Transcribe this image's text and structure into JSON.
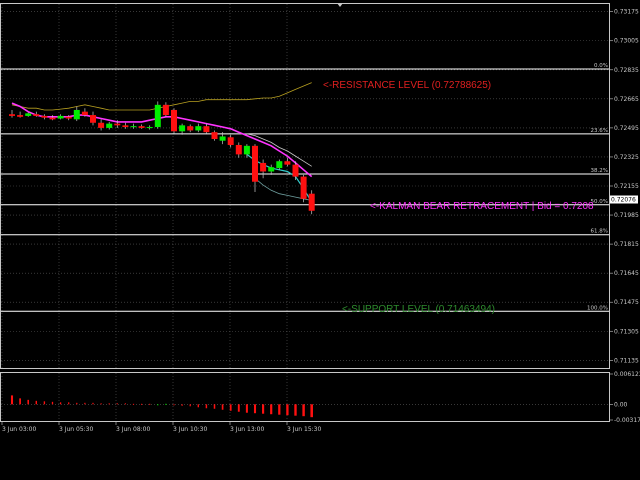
{
  "colors": {
    "background": "#000000",
    "grid": "#5a5a5a",
    "fib_line": "#ffffff",
    "bull_candle": "#00ee00",
    "bear_candle": "#ff1010",
    "kalman": "#ff33ff",
    "fast_ma": "#33cccc",
    "upper_band": "#b8a020",
    "resistance_text": "#e02020",
    "kalman_text": "#ff33ff",
    "support_text": "#2e8b2e"
  },
  "price_axis": {
    "labels": [
      "0.73175",
      "0.73005",
      "0.72835",
      "0.72665",
      "0.72495",
      "0.72325",
      "0.72155",
      "0.71985",
      "0.71815",
      "0.71645",
      "0.71475",
      "0.71305",
      "0.71135"
    ],
    "bid_tag": "0.72076"
  },
  "indicator_axis": {
    "labels": [
      "0.006123",
      "0.00",
      "-0.003171"
    ]
  },
  "time_axis": {
    "labels": [
      "3 Jun 03:00",
      "3 Jun 05:30",
      "3 Jun 08:00",
      "3 Jun 10:30",
      "3 Jun 13:00",
      "3 Jun 15:30"
    ]
  },
  "fib_levels": [
    {
      "label": "0.0%",
      "price": 0.7284
    },
    {
      "label": "23.6%",
      "price": 0.7246
    },
    {
      "label": "38.2%",
      "price": 0.72225
    },
    {
      "label": "50.0%",
      "price": 0.72045
    },
    {
      "label": "61.8%",
      "price": 0.7187
    },
    {
      "label": "100.0%",
      "price": 0.71422
    }
  ],
  "annotations": {
    "resistance": "<-RESISTANCE LEVEL (0.72788625)",
    "kalman": "<-KALMAN BEAR RETRACEMENT | Bid = 0.7208",
    "support": "<-SUPPORT LEVEL (0.71463494)"
  },
  "chart_data": {
    "type": "candlestick",
    "price_range": [
      0.7109,
      0.7322
    ],
    "indicator_range": [
      -0.003171,
      0.006123
    ],
    "candles": [
      {
        "o": 0.72575,
        "h": 0.726,
        "l": 0.72555,
        "c": 0.72565
      },
      {
        "o": 0.7257,
        "h": 0.7259,
        "l": 0.72555,
        "c": 0.7256
      },
      {
        "o": 0.72565,
        "h": 0.72585,
        "l": 0.7256,
        "c": 0.7258
      },
      {
        "o": 0.72575,
        "h": 0.7259,
        "l": 0.7256,
        "c": 0.72565
      },
      {
        "o": 0.72565,
        "h": 0.72575,
        "l": 0.72545,
        "c": 0.72555
      },
      {
        "o": 0.72555,
        "h": 0.7257,
        "l": 0.7254,
        "c": 0.72545
      },
      {
        "o": 0.7255,
        "h": 0.72575,
        "l": 0.72545,
        "c": 0.72565
      },
      {
        "o": 0.7256,
        "h": 0.7257,
        "l": 0.7254,
        "c": 0.7255
      },
      {
        "o": 0.72545,
        "h": 0.7262,
        "l": 0.72535,
        "c": 0.726
      },
      {
        "o": 0.7259,
        "h": 0.7261,
        "l": 0.7256,
        "c": 0.7257
      },
      {
        "o": 0.7257,
        "h": 0.7259,
        "l": 0.7251,
        "c": 0.72525
      },
      {
        "o": 0.72525,
        "h": 0.72545,
        "l": 0.7248,
        "c": 0.72495
      },
      {
        "o": 0.72495,
        "h": 0.7253,
        "l": 0.72485,
        "c": 0.7252
      },
      {
        "o": 0.7252,
        "h": 0.7254,
        "l": 0.72495,
        "c": 0.7251
      },
      {
        "o": 0.7251,
        "h": 0.72525,
        "l": 0.7249,
        "c": 0.725
      },
      {
        "o": 0.725,
        "h": 0.7252,
        "l": 0.7249,
        "c": 0.72505
      },
      {
        "o": 0.72505,
        "h": 0.72515,
        "l": 0.7249,
        "c": 0.72495
      },
      {
        "o": 0.72495,
        "h": 0.7251,
        "l": 0.72485,
        "c": 0.725
      },
      {
        "o": 0.725,
        "h": 0.7265,
        "l": 0.7249,
        "c": 0.7263
      },
      {
        "o": 0.7263,
        "h": 0.72645,
        "l": 0.7256,
        "c": 0.7257
      },
      {
        "o": 0.726,
        "h": 0.7261,
        "l": 0.7246,
        "c": 0.72475
      },
      {
        "o": 0.72475,
        "h": 0.7252,
        "l": 0.72455,
        "c": 0.7251
      },
      {
        "o": 0.72505,
        "h": 0.72515,
        "l": 0.7247,
        "c": 0.7248
      },
      {
        "o": 0.7248,
        "h": 0.7252,
        "l": 0.7247,
        "c": 0.72505
      },
      {
        "o": 0.72505,
        "h": 0.7252,
        "l": 0.7246,
        "c": 0.7247
      },
      {
        "o": 0.7247,
        "h": 0.7248,
        "l": 0.7242,
        "c": 0.7243
      },
      {
        "o": 0.7242,
        "h": 0.7247,
        "l": 0.724,
        "c": 0.72445
      },
      {
        "o": 0.7244,
        "h": 0.72455,
        "l": 0.7238,
        "c": 0.72395
      },
      {
        "o": 0.72395,
        "h": 0.7241,
        "l": 0.7232,
        "c": 0.7234
      },
      {
        "o": 0.7234,
        "h": 0.724,
        "l": 0.7232,
        "c": 0.7239
      },
      {
        "o": 0.7239,
        "h": 0.724,
        "l": 0.7212,
        "c": 0.7218
      },
      {
        "o": 0.7229,
        "h": 0.7231,
        "l": 0.722,
        "c": 0.7224
      },
      {
        "o": 0.7224,
        "h": 0.7228,
        "l": 0.7222,
        "c": 0.72265
      },
      {
        "o": 0.7226,
        "h": 0.7231,
        "l": 0.7225,
        "c": 0.723
      },
      {
        "o": 0.723,
        "h": 0.7232,
        "l": 0.7227,
        "c": 0.7228
      },
      {
        "o": 0.7228,
        "h": 0.723,
        "l": 0.7219,
        "c": 0.7221
      },
      {
        "o": 0.7221,
        "h": 0.7222,
        "l": 0.7206,
        "c": 0.7208
      },
      {
        "o": 0.7211,
        "h": 0.7213,
        "l": 0.7199,
        "c": 0.7201
      }
    ],
    "kalman_line": [
      0.7264,
      0.7262,
      0.7259,
      0.7257,
      0.7256,
      0.7256,
      0.7256,
      0.7256,
      0.7257,
      0.7257,
      0.7256,
      0.7255,
      0.7254,
      0.7253,
      0.7253,
      0.7253,
      0.7253,
      0.7254,
      0.7255,
      0.7256,
      0.7256,
      0.7255,
      0.7254,
      0.7253,
      0.7252,
      0.7251,
      0.725,
      0.7249,
      0.7247,
      0.7245,
      0.7243,
      0.7241,
      0.7239,
      0.7236,
      0.7233,
      0.7229,
      0.7225,
      0.7221
    ],
    "fast_ma": [
      null,
      null,
      null,
      null,
      null,
      null,
      null,
      null,
      null,
      null,
      null,
      null,
      null,
      null,
      null,
      null,
      null,
      null,
      null,
      null,
      null,
      null,
      null,
      null,
      null,
      null,
      null,
      null,
      null,
      0.7234,
      0.72305,
      0.7228,
      0.7226,
      0.7225,
      0.7224,
      0.7221,
      0.7214,
      0.7206
    ],
    "upper_band": [
      0.7263,
      0.7262,
      0.7261,
      0.7261,
      0.726,
      0.726,
      0.72605,
      0.7261,
      0.7262,
      0.7263,
      0.7262,
      0.7261,
      0.726,
      0.726,
      0.726,
      0.726,
      0.726,
      0.726,
      0.7261,
      0.7262,
      0.7263,
      0.7264,
      0.7265,
      0.7265,
      0.7266,
      0.7266,
      0.7266,
      0.7266,
      0.7266,
      0.7266,
      0.72665,
      0.7267,
      0.7267,
      0.7268,
      0.727,
      0.7272,
      0.7274,
      0.7276
    ],
    "lower_band": [
      null,
      null,
      null,
      null,
      null,
      null,
      null,
      null,
      null,
      null,
      null,
      null,
      null,
      null,
      null,
      null,
      null,
      null,
      null,
      null,
      null,
      null,
      null,
      null,
      null,
      null,
      null,
      null,
      null,
      null,
      0.722,
      0.7216,
      0.7213,
      0.7211,
      0.721,
      0.7209,
      0.7208,
      0.7207
    ],
    "upper_band_2": [
      null,
      null,
      null,
      null,
      null,
      null,
      null,
      null,
      null,
      null,
      null,
      null,
      null,
      null,
      null,
      null,
      null,
      null,
      null,
      null,
      null,
      null,
      null,
      null,
      null,
      null,
      null,
      null,
      0.7246,
      0.7246,
      0.7245,
      0.7243,
      0.7241,
      0.7238,
      0.7236,
      0.7233,
      0.723,
      0.7227
    ],
    "histogram": [
      0.0018,
      0.0012,
      0.0009,
      0.0007,
      0.0006,
      0.0005,
      0.0004,
      0.0004,
      0.0003,
      0.0003,
      0.0003,
      0.0002,
      0.0002,
      0.0002,
      0.0002,
      0.0001,
      0.0001,
      0.0001,
      -0.0001,
      0.0001,
      -0.0002,
      -0.0003,
      -0.0004,
      -0.0006,
      -0.0008,
      -0.0009,
      -0.0011,
      -0.0013,
      -0.0015,
      -0.0017,
      -0.0018,
      -0.0019,
      -0.002,
      -0.0021,
      -0.0022,
      -0.0023,
      -0.0024,
      -0.0026
    ]
  }
}
